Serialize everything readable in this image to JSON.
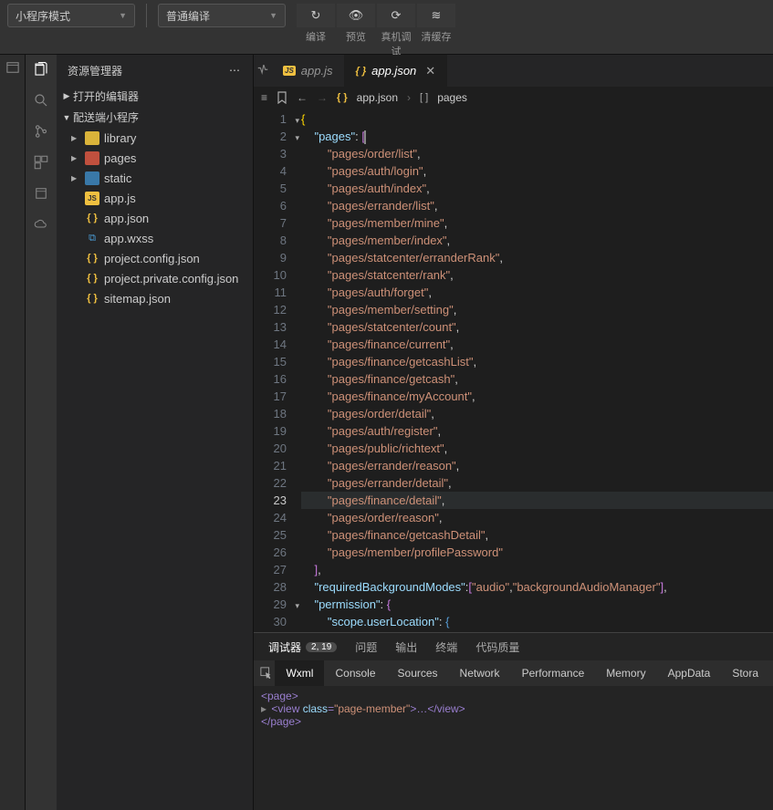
{
  "top": {
    "mode": "小程序模式",
    "compile": "普通编译",
    "btns": [
      {
        "glyph": "↻",
        "label": "编译"
      },
      {
        "glyph": "👁",
        "label": "预览"
      },
      {
        "glyph": "⟳",
        "label": "真机调试"
      },
      {
        "glyph": "≋",
        "label": "清缓存"
      }
    ]
  },
  "explorer": {
    "title": "资源管理器",
    "sec1": "打开的编辑器",
    "sec2": "配送端小程序",
    "tree": [
      {
        "d": 1,
        "ar": "▶",
        "ic": "folder-y",
        "t": "library"
      },
      {
        "d": 1,
        "ar": "▶",
        "ic": "folder-r",
        "t": "pages"
      },
      {
        "d": 1,
        "ar": "▶",
        "ic": "folder-b",
        "t": "static"
      },
      {
        "d": 1,
        "ar": "",
        "ic": "js",
        "g": "JS",
        "t": "app.js"
      },
      {
        "d": 1,
        "ar": "",
        "ic": "json",
        "g": "{ }",
        "t": "app.json"
      },
      {
        "d": 1,
        "ar": "",
        "ic": "wxss",
        "g": "⧉",
        "t": "app.wxss"
      },
      {
        "d": 1,
        "ar": "",
        "ic": "json",
        "g": "{ }",
        "t": "project.config.json"
      },
      {
        "d": 1,
        "ar": "",
        "ic": "json",
        "g": "{ }",
        "t": "project.private.config.json"
      },
      {
        "d": 1,
        "ar": "",
        "ic": "json",
        "g": "{ }",
        "t": "sitemap.json"
      }
    ]
  },
  "tabs": [
    {
      "icon": "js",
      "g": "JS",
      "label": "app.js",
      "active": false
    },
    {
      "icon": "json",
      "g": "{ }",
      "label": "app.json",
      "active": true,
      "close": true
    }
  ],
  "breadcrumb": {
    "file": "app.json",
    "symbol": "pages",
    "fileGlyph": "{ }",
    "symGlyph": "[ ]"
  },
  "code": {
    "lines": [
      {
        "n": 1,
        "fold": "▾",
        "raw": "{",
        "seg": [
          [
            "br",
            "{"
          ]
        ]
      },
      {
        "n": 2,
        "fold": "▾",
        "raw": "  \"pages\": [",
        "seg": [
          [
            "",
            "    "
          ],
          [
            "kw",
            "\"pages\""
          ],
          [
            "pu",
            ": "
          ],
          [
            "br2",
            "["
          ]
        ],
        "boxAfter": true
      },
      {
        "n": 3,
        "raw": "",
        "seg": [
          [
            "",
            "        "
          ],
          [
            "str",
            "\"pages/order/list\""
          ],
          [
            "pu",
            ","
          ]
        ]
      },
      {
        "n": 4,
        "raw": "",
        "seg": [
          [
            "",
            "        "
          ],
          [
            "str",
            "\"pages/auth/login\""
          ],
          [
            "pu",
            ","
          ]
        ]
      },
      {
        "n": 5,
        "raw": "",
        "seg": [
          [
            "",
            "        "
          ],
          [
            "str",
            "\"pages/auth/index\""
          ],
          [
            "pu",
            ","
          ]
        ]
      },
      {
        "n": 6,
        "raw": "",
        "seg": [
          [
            "",
            "        "
          ],
          [
            "str",
            "\"pages/errander/list\""
          ],
          [
            "pu",
            ","
          ]
        ]
      },
      {
        "n": 7,
        "raw": "",
        "seg": [
          [
            "",
            "        "
          ],
          [
            "str",
            "\"pages/member/mine\""
          ],
          [
            "pu",
            ","
          ]
        ]
      },
      {
        "n": 8,
        "raw": "",
        "seg": [
          [
            "",
            "        "
          ],
          [
            "str",
            "\"pages/member/index\""
          ],
          [
            "pu",
            ","
          ]
        ]
      },
      {
        "n": 9,
        "raw": "",
        "seg": [
          [
            "",
            "        "
          ],
          [
            "str",
            "\"pages/statcenter/erranderRank\""
          ],
          [
            "pu",
            ","
          ]
        ]
      },
      {
        "n": 10,
        "raw": "",
        "seg": [
          [
            "",
            "        "
          ],
          [
            "str",
            "\"pages/statcenter/rank\""
          ],
          [
            "pu",
            ","
          ]
        ]
      },
      {
        "n": 11,
        "raw": "",
        "seg": [
          [
            "",
            "        "
          ],
          [
            "str",
            "\"pages/auth/forget\""
          ],
          [
            "pu",
            ","
          ]
        ]
      },
      {
        "n": 12,
        "raw": "",
        "seg": [
          [
            "",
            "        "
          ],
          [
            "str",
            "\"pages/member/setting\""
          ],
          [
            "pu",
            ","
          ]
        ]
      },
      {
        "n": 13,
        "raw": "",
        "seg": [
          [
            "",
            "        "
          ],
          [
            "str",
            "\"pages/statcenter/count\""
          ],
          [
            "pu",
            ","
          ]
        ]
      },
      {
        "n": 14,
        "raw": "",
        "seg": [
          [
            "",
            "        "
          ],
          [
            "str",
            "\"pages/finance/current\""
          ],
          [
            "pu",
            ","
          ]
        ]
      },
      {
        "n": 15,
        "raw": "",
        "seg": [
          [
            "",
            "        "
          ],
          [
            "str",
            "\"pages/finance/getcashList\""
          ],
          [
            "pu",
            ","
          ]
        ]
      },
      {
        "n": 16,
        "raw": "",
        "seg": [
          [
            "",
            "        "
          ],
          [
            "str",
            "\"pages/finance/getcash\""
          ],
          [
            "pu",
            ","
          ]
        ]
      },
      {
        "n": 17,
        "raw": "",
        "seg": [
          [
            "",
            "        "
          ],
          [
            "str",
            "\"pages/finance/myAccount\""
          ],
          [
            "pu",
            ","
          ]
        ]
      },
      {
        "n": 18,
        "raw": "",
        "seg": [
          [
            "",
            "        "
          ],
          [
            "str",
            "\"pages/order/detail\""
          ],
          [
            "pu",
            ","
          ]
        ]
      },
      {
        "n": 19,
        "raw": "",
        "seg": [
          [
            "",
            "        "
          ],
          [
            "str",
            "\"pages/auth/register\""
          ],
          [
            "pu",
            ","
          ]
        ]
      },
      {
        "n": 20,
        "raw": "",
        "seg": [
          [
            "",
            "        "
          ],
          [
            "str",
            "\"pages/public/richtext\""
          ],
          [
            "pu",
            ","
          ]
        ]
      },
      {
        "n": 21,
        "raw": "",
        "seg": [
          [
            "",
            "        "
          ],
          [
            "str",
            "\"pages/errander/reason\""
          ],
          [
            "pu",
            ","
          ]
        ]
      },
      {
        "n": 22,
        "raw": "",
        "seg": [
          [
            "",
            "        "
          ],
          [
            "str",
            "\"pages/errander/detail\""
          ],
          [
            "pu",
            ","
          ]
        ]
      },
      {
        "n": 23,
        "hl": true,
        "raw": "",
        "seg": [
          [
            "",
            "        "
          ],
          [
            "str",
            "\"pages/finance/detail\""
          ],
          [
            "pu",
            ","
          ]
        ]
      },
      {
        "n": 24,
        "raw": "",
        "seg": [
          [
            "",
            "        "
          ],
          [
            "str",
            "\"pages/order/reason\""
          ],
          [
            "pu",
            ","
          ]
        ]
      },
      {
        "n": 25,
        "raw": "",
        "seg": [
          [
            "",
            "        "
          ],
          [
            "str",
            "\"pages/finance/getcashDetail\""
          ],
          [
            "pu",
            ","
          ]
        ]
      },
      {
        "n": 26,
        "raw": "",
        "seg": [
          [
            "",
            "        "
          ],
          [
            "str",
            "\"pages/member/profilePassword\""
          ]
        ]
      },
      {
        "n": 27,
        "raw": "",
        "seg": [
          [
            "",
            "    "
          ],
          [
            "br2",
            "]"
          ],
          [
            "pu",
            ","
          ]
        ]
      },
      {
        "n": 28,
        "raw": "",
        "seg": [
          [
            "",
            "    "
          ],
          [
            "kw",
            "\"requiredBackgroundModes\""
          ],
          [
            "pu",
            ":"
          ],
          [
            "br2",
            "["
          ],
          [
            "str",
            "\"audio\""
          ],
          [
            "pu",
            ","
          ],
          [
            "str",
            "\"backgroundAudioManager\""
          ],
          [
            "br2",
            "]"
          ],
          [
            "pu",
            ","
          ]
        ]
      },
      {
        "n": 29,
        "fold": "▾",
        "raw": "",
        "seg": [
          [
            "",
            "    "
          ],
          [
            "kw",
            "\"permission\""
          ],
          [
            "pu",
            ": "
          ],
          [
            "br2",
            "{"
          ]
        ]
      },
      {
        "n": 30,
        "raw": "",
        "seg": [
          [
            "",
            "        "
          ],
          [
            "kw",
            "\"scope.userLocation\""
          ],
          [
            "pu",
            ": "
          ],
          [
            "br3",
            "{"
          ]
        ]
      }
    ]
  },
  "devtools": {
    "primary": [
      {
        "t": "调试器",
        "b": "2, 19",
        "act": true
      },
      {
        "t": "问题"
      },
      {
        "t": "输出"
      },
      {
        "t": "终端"
      },
      {
        "t": "代码质量"
      }
    ],
    "sub": [
      "Wxml",
      "Console",
      "Sources",
      "Network",
      "Performance",
      "Memory",
      "AppData",
      "Stora"
    ],
    "wxml": {
      "l1": "<page>",
      "l2pre": "▸ ",
      "l2a": "<view ",
      "l2b": "class",
      "l2c": "=",
      "l2d": "\"page-member\"",
      "l2e": ">…</view>",
      "l3": "</page>"
    }
  }
}
